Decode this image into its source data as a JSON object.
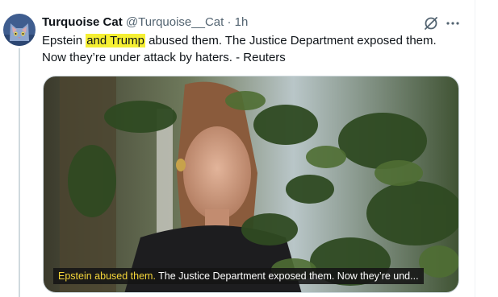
{
  "tweet": {
    "author_name": "Turquoise Cat",
    "handle": "@Turquoise__Cat",
    "separator": "·",
    "time": "1h",
    "text_part1": "Epstein ",
    "text_highlight": "and Trump",
    "text_part2": " abused them. The Justice Department exposed them. Now they’re under attack by haters. - Reuters"
  },
  "media": {
    "caption_highlight": "Epstein abused them.",
    "caption_rest": " The Justice Department exposed them. Now they’re und..."
  },
  "icons": {
    "grok": "grok-icon",
    "more": "more-icon"
  },
  "colors": {
    "highlight": "#f5ef33",
    "caption_highlight": "#f5d63a",
    "secondary_text": "#536471",
    "avatar_bg": "#3f5d8f"
  }
}
